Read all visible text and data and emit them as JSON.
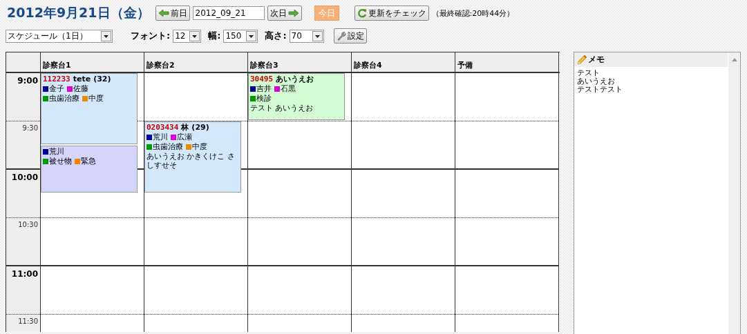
{
  "header": {
    "title": "2012年9月21日（金）",
    "prev_button": "前日",
    "date_field": "2012_09_21",
    "next_button": "次日",
    "today_button": "今日",
    "refresh_button": "更新をチェック",
    "last_checked": "（最終確認:20時44分）"
  },
  "toolbar": {
    "view_select": "スケジュール（1日）",
    "font_label": "フォント:",
    "font_select": "12",
    "width_label": "幅:",
    "width_select": "150",
    "height_label": "高さ:",
    "height_select": "70",
    "settings_button": "設定"
  },
  "schedule": {
    "slots": [
      {
        "label": "9:00",
        "kind": "hour"
      },
      {
        "label": "9:30",
        "kind": "half"
      },
      {
        "label": "10:00",
        "kind": "hour"
      },
      {
        "label": "10:30",
        "kind": "half"
      },
      {
        "label": "11:00",
        "kind": "hour"
      },
      {
        "label": "11:30",
        "kind": "half"
      }
    ],
    "columns": [
      {
        "title": "診察台1",
        "appointments": [
          {
            "color": "#d4e8fc",
            "number": "112233",
            "name": "tete",
            "age": "(32)",
            "tag_rows": [
              [
                {
                  "text": "金子",
                  "color": "#000099"
                },
                {
                  "text": "佐藤",
                  "color": "#dd00dd"
                }
              ],
              [
                {
                  "text": "虫歯治療",
                  "color": "#009900"
                },
                {
                  "text": "中度",
                  "color": "#ee8800"
                }
              ]
            ]
          },
          {
            "color": "#d4d4fc",
            "tag_rows": [
              [
                {
                  "text": "荒川",
                  "color": "#000099"
                }
              ],
              [
                {
                  "text": "被せ物",
                  "color": "#009900"
                },
                {
                  "text": "緊急",
                  "color": "#ee8800"
                }
              ]
            ]
          }
        ]
      },
      {
        "title": "診察台2",
        "appointments": [
          {
            "color": "#d4e8fc",
            "number": "0203434",
            "name": "林",
            "age": "(29)",
            "tag_rows": [
              [
                {
                  "text": "荒川",
                  "color": "#000099"
                },
                {
                  "text": "広瀬",
                  "color": "#dd00dd"
                }
              ],
              [
                {
                  "text": "虫歯治療",
                  "color": "#009900"
                },
                {
                  "text": "中度",
                  "color": "#ee8800"
                }
              ]
            ],
            "note": "あいうえお かきくけこ さしすせそ"
          }
        ]
      },
      {
        "title": "診察台3",
        "appointments": [
          {
            "color": "#d4fcd4",
            "number": "30495",
            "name": "あいうえお",
            "tag_rows": [
              [
                {
                  "text": "吉井",
                  "color": "#000099"
                },
                {
                  "text": "石黒",
                  "color": "#dd00dd"
                }
              ],
              [
                {
                  "text": "検診",
                  "color": "#009900"
                }
              ]
            ],
            "note": "テスト あいうえお"
          }
        ]
      },
      {
        "title": "診察台4"
      },
      {
        "title": "予備"
      }
    ]
  },
  "memo": {
    "title": "メモ",
    "lines": [
      "テスト",
      "あいうえお",
      "テストテスト"
    ]
  }
}
